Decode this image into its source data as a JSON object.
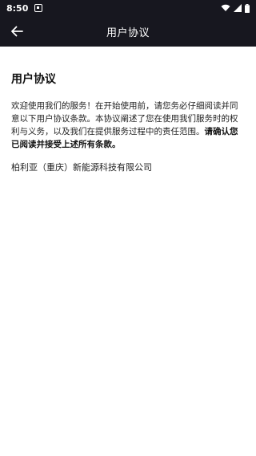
{
  "status_bar": {
    "time": "8:50"
  },
  "app_bar": {
    "title": "用户协议"
  },
  "content": {
    "title": "用户协议",
    "body_text": "欢迎使用我们的服务！在开始使用前，请您务必仔细阅读并同意以下用户协议条款。本协议阐述了您在使用我们服务时的权利与义务，以及我们在提供服务过程中的责任范围。",
    "body_strong": "请确认您已阅读并接受上述所有条款。",
    "company": "柏利亚（重庆）新能源科技有限公司"
  },
  "icons": {
    "back": "arrow-left-icon",
    "wifi": "wifi-icon",
    "signal": "cellular-signal-icon",
    "battery": "battery-icon",
    "notification": "notification-icon"
  },
  "colors": {
    "bar_bg": "#17171f",
    "content_bg": "#ffffff",
    "text": "#222222"
  }
}
